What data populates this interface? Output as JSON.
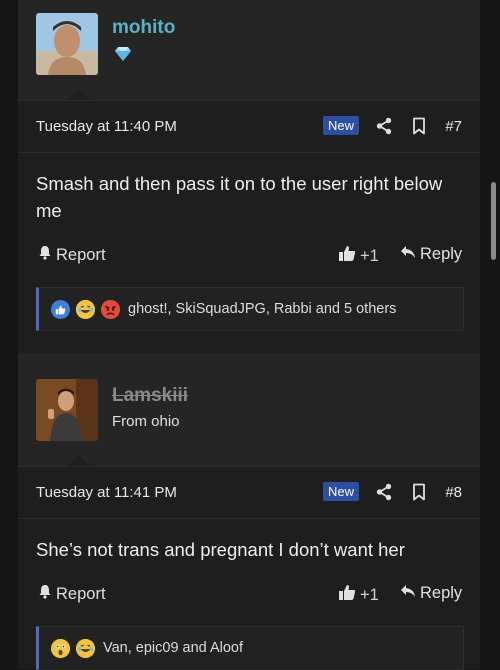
{
  "posts": [
    {
      "username": "mohito",
      "username_color": "#59b0c9",
      "badge_icon": "diamond-icon",
      "date": "Tuesday at 11:40 PM",
      "new_label": "New",
      "number": "#7",
      "message": "Smash and then pass it on to the user right below me",
      "report_label": "Report",
      "like_label": "+1",
      "reply_label": "Reply",
      "reactions_text": "ghost!, SkiSquadJPG, Rabbi and 5 others",
      "reaction_icons": [
        "like-icon",
        "laughing-icon",
        "angry-icon"
      ]
    },
    {
      "username": "Lamskiii",
      "username_color": "#8a8a8a",
      "user_title": "From ohio",
      "date": "Tuesday at 11:41 PM",
      "new_label": "New",
      "number": "#8",
      "message": "She’s not trans and pregnant I don’t want her",
      "report_label": "Report",
      "like_label": "+1",
      "reply_label": "Reply",
      "reactions_text": "Van, epic09 and Aloof",
      "reaction_icons": [
        "astonished-icon",
        "laughing-icon"
      ]
    }
  ]
}
